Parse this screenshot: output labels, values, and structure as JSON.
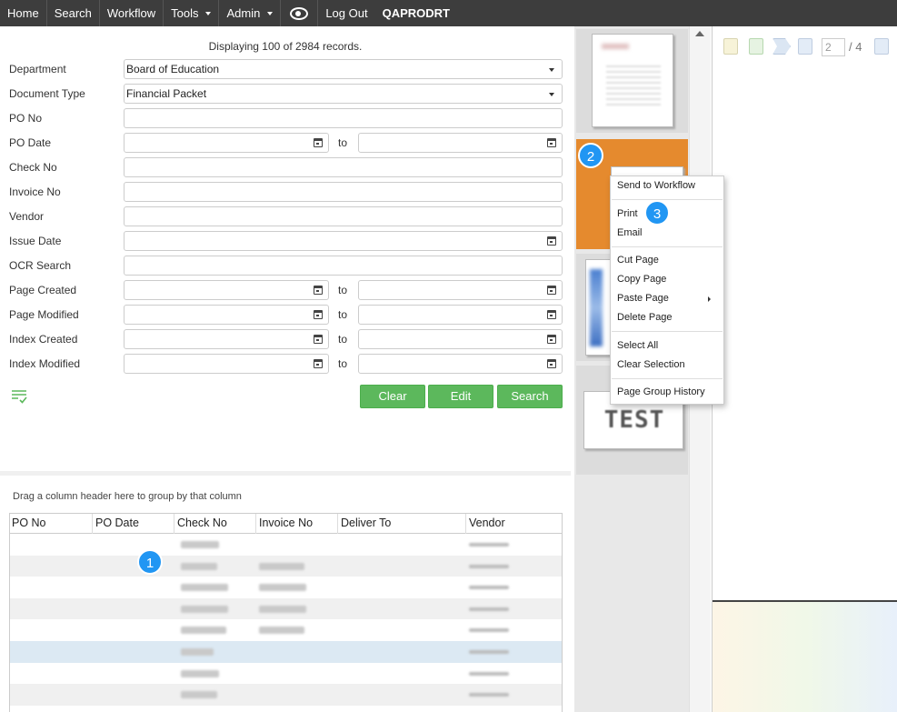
{
  "nav": {
    "home": "Home",
    "search": "Search",
    "workflow": "Workflow",
    "tools": "Tools",
    "admin": "Admin",
    "logout": "Log Out",
    "user": "QAPRODRT",
    "eye_icon": "eye-icon"
  },
  "form": {
    "record_count": "Displaying 100 of 2984 records.",
    "to": "to",
    "department": {
      "label": "Department",
      "value": "Board of Education"
    },
    "document_type": {
      "label": "Document Type",
      "value": "Financial Packet"
    },
    "po_no": {
      "label": "PO No",
      "value": ""
    },
    "po_date": {
      "label": "PO Date"
    },
    "check_no": {
      "label": "Check No",
      "value": ""
    },
    "invoice_no": {
      "label": "Invoice No",
      "value": ""
    },
    "vendor": {
      "label": "Vendor",
      "value": ""
    },
    "issue_date": {
      "label": "Issue Date"
    },
    "ocr_search": {
      "label": "OCR Search",
      "value": ""
    },
    "page_created": {
      "label": "Page Created"
    },
    "page_modified": {
      "label": "Page Modified"
    },
    "index_created": {
      "label": "Index Created"
    },
    "index_modified": {
      "label": "Index Modified"
    },
    "buttons": {
      "clear": "Clear",
      "edit": "Edit",
      "search": "Search"
    },
    "accent_color": "#5cb85c"
  },
  "grid": {
    "group_hint": "Drag a column header here to group by that column",
    "columns": [
      "PO No",
      "PO Date",
      "Check No",
      "Invoice No",
      "Deliver To",
      "Vendor"
    ],
    "row_count_visible": 8,
    "selected_row": 5
  },
  "annotations": {
    "one": "1",
    "two": "2",
    "three": "3",
    "color": "#2196f3"
  },
  "thumbnails": {
    "selected_index": 1,
    "selected_color": "#e58a2e",
    "test_label": "TEST"
  },
  "context_menu": {
    "send_to_workflow": "Send to Workflow",
    "print": "Print",
    "email": "Email",
    "cut_page": "Cut Page",
    "copy_page": "Copy Page",
    "paste_page": "Paste Page",
    "delete_page": "Delete Page",
    "select_all": "Select All",
    "clear_selection": "Clear Selection",
    "page_group_history": "Page Group History"
  },
  "viewer": {
    "current_page": "2",
    "total_pages": "/ 4"
  }
}
